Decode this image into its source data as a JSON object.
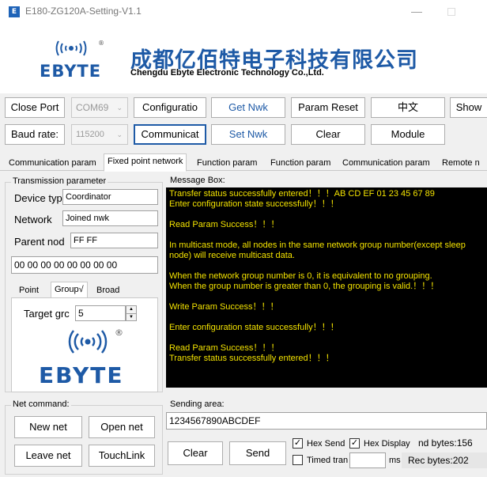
{
  "window": {
    "title": "E180-ZG120A-Setting-V1.1",
    "app_icon": "E",
    "minimize_glyph": "—"
  },
  "banner": {
    "logo_text": "EBYTE",
    "logo_registered": "®",
    "company_cn": "成都亿佰特电子科技有限公司",
    "company_en": "Chengdu Ebyte Electronic Technology Co.,Ltd.",
    "brand_color": "#1e5aa6"
  },
  "toolbar": {
    "close_port": "Close Port",
    "port_value": "COM69",
    "configuration": "Configuratio",
    "get_nwk": "Get Nwk",
    "param_reset": "Param Reset",
    "language": "中文",
    "show": "Show",
    "baud_label": "Baud rate:",
    "baud_value": "115200",
    "communication": "Communicat",
    "set_nwk": "Set Nwk",
    "clear": "Clear",
    "module": "Module"
  },
  "tabs": [
    {
      "label": "Communication param"
    },
    {
      "label": "Fixed point network"
    },
    {
      "label": "Function param"
    },
    {
      "label": "Function param"
    },
    {
      "label": "Communication param"
    },
    {
      "label": "Remote n"
    }
  ],
  "transmission": {
    "title": "Transmission parameter",
    "device_type_label": "Device typ",
    "device_type_value": "Coordinator",
    "network_label": "Network",
    "network_value": "Joined nwk",
    "parent_label": "Parent nod",
    "parent_value": "FF FF",
    "address_value": "00 00 00 00 00 00 00 00",
    "subtabs": [
      "Point",
      "Group√",
      "Broad"
    ],
    "target_label": "Target grc",
    "target_value": "5",
    "logo_text": "EBYTE",
    "logo_registered": "®"
  },
  "message_box": {
    "title": "Message Box:",
    "lines": [
      "Transfer status successfully entered！！！AB CD EF 01 23 45 67 89",
      "Enter configuration state successfully！！！",
      "",
      "Read Param Success！！！",
      "",
      "In multicast mode, all nodes in the same network group number(except sleep",
      "node) will receive multicast data.",
      "",
      "When the network group number is 0, it is equivalent to no grouping.",
      "When the group number is greater than 0, the grouping is valid.！！！",
      "",
      "Write Param Success！！！",
      "",
      "Enter configuration state successfully！！！",
      "",
      "Read Param Success！！！",
      "Transfer status successfully entered！！！"
    ],
    "text_color": "#f4e300",
    "background": "#000000"
  },
  "net_command": {
    "title": "Net command:",
    "new_net": "New net",
    "open_net": "Open net",
    "leave_net": "Leave net",
    "touch_link": "TouchLink"
  },
  "sending": {
    "title": "Sending area:",
    "value": "1234567890ABCDEF",
    "clear": "Clear",
    "send": "Send",
    "hex_send": "Hex Send",
    "hex_send_checked": true,
    "hex_display": "Hex Display",
    "hex_display_checked": true,
    "send_bytes": "nd bytes:156",
    "timed_label": "Timed tran",
    "timed_unit": "ms",
    "rec_bytes": "Rec bytes:202"
  }
}
